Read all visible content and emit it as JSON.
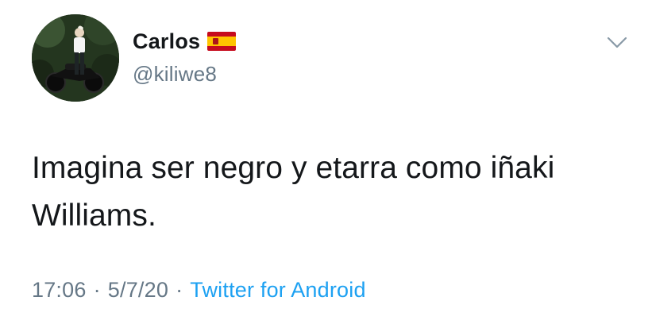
{
  "user": {
    "display_name": "Carlos",
    "flag_icon": "spain-flag-emoji",
    "handle": "@kiliwe8"
  },
  "tweet": {
    "text": "Imagina ser negro y etarra como iñaki Williams."
  },
  "meta": {
    "time": "17:06",
    "separator_1": "·",
    "date": "5/7/20",
    "separator_2": "·",
    "source": "Twitter for Android"
  },
  "colors": {
    "text_primary": "#14171a",
    "text_secondary": "#657786",
    "link": "#1da1f2"
  },
  "icons": {
    "menu": "chevron-down-icon"
  }
}
